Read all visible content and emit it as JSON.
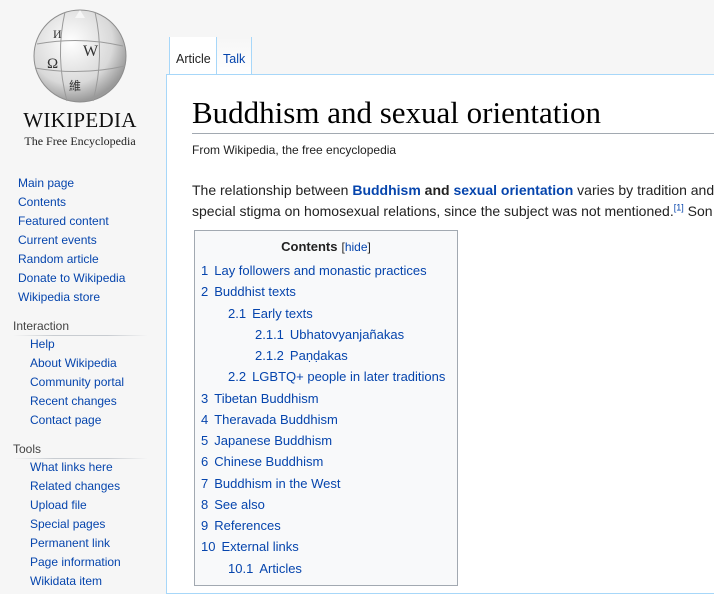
{
  "logo": {
    "wordmark": "WIKIPEDIA",
    "tagline": "The Free Encyclopedia",
    "glyphs": [
      "Ω",
      "W",
      "И",
      "維"
    ]
  },
  "sidebar": {
    "main": [
      "Main page",
      "Contents",
      "Featured content",
      "Current events",
      "Random article",
      "Donate to Wikipedia",
      "Wikipedia store"
    ],
    "interaction_heading": "Interaction",
    "interaction": [
      "Help",
      "About Wikipedia",
      "Community portal",
      "Recent changes",
      "Contact page"
    ],
    "tools_heading": "Tools",
    "tools": [
      "What links here",
      "Related changes",
      "Upload file",
      "Special pages",
      "Permanent link",
      "Page information",
      "Wikidata item"
    ]
  },
  "tabs": {
    "article": "Article",
    "talk": "Talk"
  },
  "article": {
    "title": "Buddhism and sexual orientation",
    "site_sub": "From Wikipedia, the free encyclopedia",
    "intro": {
      "p1_a": "The relationship between ",
      "link1": "Buddhism",
      "p1_b": " and ",
      "link2": "sexual orientation",
      "p1_c": " varies by tradition and",
      "p2": "special stigma on homosexual relations, since the subject was not mentioned.",
      "ref": "[1]",
      "p2_tail": " Son"
    }
  },
  "toc": {
    "title": "Contents",
    "hide": "hide",
    "items": [
      {
        "num": "1",
        "text": "Lay followers and monastic practices"
      },
      {
        "num": "2",
        "text": "Buddhist texts"
      },
      {
        "num": "2.1",
        "text": "Early texts"
      },
      {
        "num": "2.1.1",
        "text": "Ubhatovyanjañakas"
      },
      {
        "num": "2.1.2",
        "text": "Paṇḍakas"
      },
      {
        "num": "2.2",
        "text": "LGBTQ+ people in later traditions"
      },
      {
        "num": "3",
        "text": "Tibetan Buddhism"
      },
      {
        "num": "4",
        "text": "Theravada Buddhism"
      },
      {
        "num": "5",
        "text": "Japanese Buddhism"
      },
      {
        "num": "6",
        "text": "Chinese Buddhism"
      },
      {
        "num": "7",
        "text": "Buddhism in the West"
      },
      {
        "num": "8",
        "text": "See also"
      },
      {
        "num": "9",
        "text": "References"
      },
      {
        "num": "10",
        "text": "External links"
      },
      {
        "num": "10.1",
        "text": "Articles"
      }
    ]
  }
}
